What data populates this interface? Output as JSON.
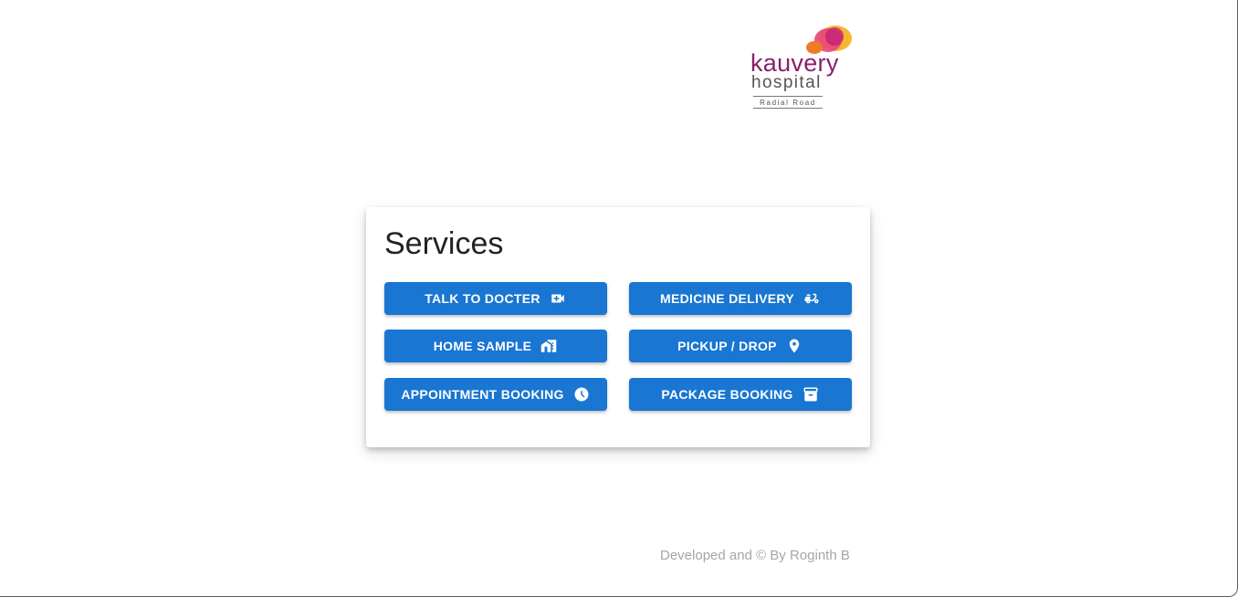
{
  "logo": {
    "name": "kauvery",
    "sub": "hospital",
    "branch": "Radial Road",
    "colors": {
      "primary": "#8b1f6b",
      "accent1": "#e8457a",
      "accent2": "#f5b731"
    }
  },
  "services": {
    "title": "Services",
    "buttons": [
      {
        "label": "TALK TO DOCTER",
        "icon": "video-call-icon"
      },
      {
        "label": "MEDICINE DELIVERY",
        "icon": "delivery-scooter-icon"
      },
      {
        "label": "HOME SAMPLE",
        "icon": "home-work-icon"
      },
      {
        "label": "PICKUP / DROP",
        "icon": "location-pin-icon"
      },
      {
        "label": "APPOINTMENT BOOKING",
        "icon": "clock-icon"
      },
      {
        "label": "PACKAGE BOOKING",
        "icon": "archive-box-icon"
      }
    ]
  },
  "footer": {
    "text": "Developed and © By Roginth B"
  },
  "colors": {
    "button": "#1976d2",
    "footer_text": "#a6a6a6"
  }
}
